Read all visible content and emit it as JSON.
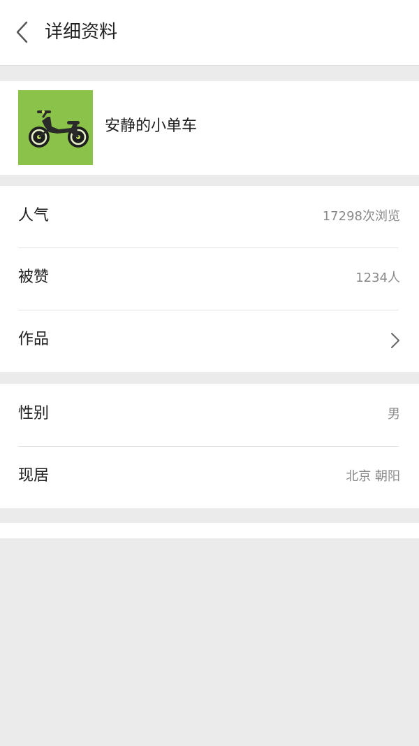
{
  "header": {
    "title": "详细资料",
    "back_icon": "chevron-left-icon"
  },
  "profile": {
    "name": "安静的小单车",
    "avatar_icon": "balance-bike-icon",
    "avatar_bg": "#8bc34a"
  },
  "stats": [
    {
      "label": "人气",
      "value": "17298次浏览"
    },
    {
      "label": "被赞",
      "value": "1234人"
    },
    {
      "label": "作品",
      "icon": "chevron-right-icon"
    }
  ],
  "info": [
    {
      "label": "性别",
      "value": "男"
    },
    {
      "label": "现居",
      "value": "北京 朝阳"
    }
  ]
}
